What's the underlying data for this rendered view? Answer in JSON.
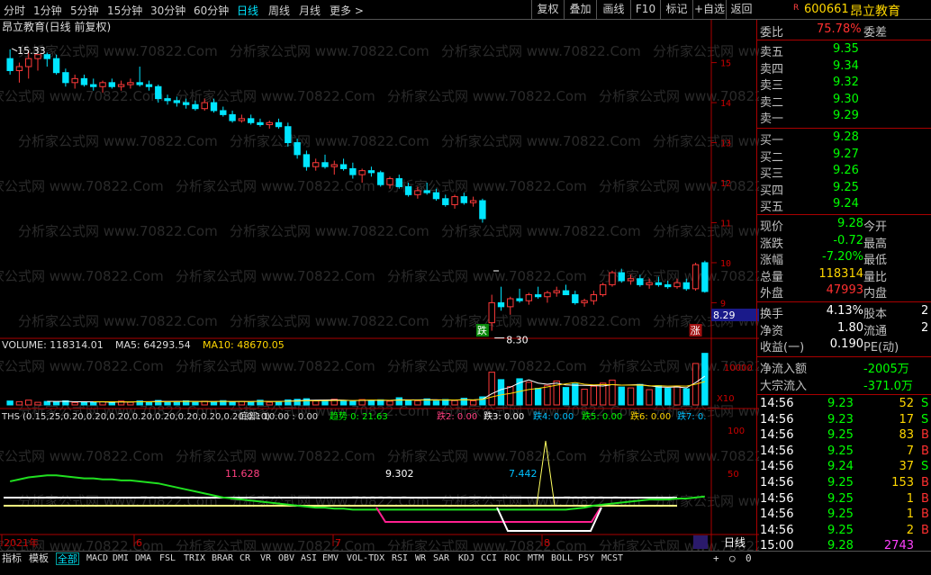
{
  "topbar": {
    "periods": [
      "分时",
      "1分钟",
      "5分钟",
      "15分钟",
      "30分钟",
      "60分钟",
      "日线",
      "周线",
      "月线",
      "更多 >"
    ],
    "active": "日线",
    "right": [
      "复权",
      "叠加",
      "画线",
      "F10",
      "标记",
      "+自选",
      "返回"
    ]
  },
  "stock": {
    "code": "600661",
    "name": "昂立教育",
    "mark": "R"
  },
  "chart_title": "昂立教育(日线 前复权)",
  "chart_data": [
    {
      "type": "candlestick",
      "ylim": [
        8.2,
        15.8
      ],
      "y_ticks": [
        9.0,
        10.0,
        11.0,
        12.0,
        13.0,
        14.0,
        15.0
      ],
      "high_label": "15.33",
      "low_label": "8.30",
      "current_price_label": "8.29",
      "markers": [
        "跌",
        "涨"
      ],
      "candles": [
        [
          15.1,
          15.33,
          14.7,
          14.8
        ],
        [
          14.8,
          15.0,
          14.5,
          14.9
        ],
        [
          14.9,
          15.3,
          14.6,
          15.1
        ],
        [
          15.1,
          15.2,
          14.8,
          15.2
        ],
        [
          15.2,
          15.25,
          14.9,
          15.1
        ],
        [
          15.1,
          15.2,
          14.7,
          14.75
        ],
        [
          14.75,
          14.85,
          14.4,
          14.5
        ],
        [
          14.5,
          14.7,
          14.35,
          14.6
        ],
        [
          14.6,
          14.7,
          14.4,
          14.45
        ],
        [
          14.45,
          14.6,
          14.3,
          14.4
        ],
        [
          14.4,
          14.55,
          14.25,
          14.5
        ],
        [
          14.5,
          14.6,
          14.35,
          14.4
        ],
        [
          14.4,
          14.55,
          14.3,
          14.45
        ],
        [
          14.45,
          14.6,
          14.35,
          14.5
        ],
        [
          14.5,
          14.9,
          14.4,
          14.45
        ],
        [
          14.45,
          14.55,
          14.3,
          14.4
        ],
        [
          14.4,
          14.45,
          14.0,
          14.1
        ],
        [
          14.1,
          14.2,
          13.95,
          14.05
        ],
        [
          14.05,
          14.15,
          13.9,
          14.0
        ],
        [
          14.0,
          14.1,
          13.85,
          13.95
        ],
        [
          13.95,
          14.05,
          13.8,
          13.85
        ],
        [
          13.85,
          14.1,
          13.8,
          14.0
        ],
        [
          14.0,
          14.1,
          13.75,
          13.8
        ],
        [
          13.8,
          13.9,
          13.65,
          13.7
        ],
        [
          13.7,
          13.8,
          13.5,
          13.55
        ],
        [
          13.55,
          13.7,
          13.5,
          13.6
        ],
        [
          13.6,
          13.7,
          13.45,
          13.5
        ],
        [
          13.5,
          13.6,
          13.4,
          13.45
        ],
        [
          13.45,
          13.55,
          13.35,
          13.5
        ],
        [
          13.5,
          13.6,
          13.35,
          13.4
        ],
        [
          13.4,
          13.5,
          12.9,
          13.0
        ],
        [
          13.0,
          13.1,
          12.6,
          12.7
        ],
        [
          12.7,
          12.8,
          12.3,
          12.4
        ],
        [
          12.4,
          12.6,
          12.3,
          12.5
        ],
        [
          12.5,
          12.7,
          12.35,
          12.4
        ],
        [
          12.4,
          12.55,
          12.2,
          12.45
        ],
        [
          12.45,
          12.6,
          12.3,
          12.35
        ],
        [
          12.35,
          12.5,
          12.1,
          12.2
        ],
        [
          12.2,
          12.35,
          12.0,
          12.3
        ],
        [
          12.3,
          12.4,
          12.15,
          12.25
        ],
        [
          12.25,
          12.3,
          11.9,
          11.95
        ],
        [
          11.95,
          12.15,
          11.85,
          12.1
        ],
        [
          12.1,
          12.2,
          11.85,
          11.9
        ],
        [
          11.9,
          12.0,
          11.65,
          11.7
        ],
        [
          11.7,
          11.9,
          11.6,
          11.8
        ],
        [
          11.8,
          12.0,
          11.7,
          11.75
        ],
        [
          11.75,
          11.85,
          11.55,
          11.6
        ],
        [
          11.6,
          11.7,
          11.4,
          11.45
        ],
        [
          11.45,
          11.7,
          11.35,
          11.65
        ],
        [
          11.65,
          11.75,
          11.45,
          11.5
        ],
        [
          11.5,
          11.65,
          11.4,
          11.55
        ],
        [
          11.55,
          11.6,
          11.0,
          11.1
        ],
        [
          8.5,
          9.2,
          8.3,
          9.0
        ],
        [
          9.0,
          9.4,
          8.8,
          8.9
        ],
        [
          8.9,
          9.15,
          8.7,
          9.1
        ],
        [
          9.1,
          9.35,
          9.0,
          9.05
        ],
        [
          9.05,
          9.25,
          8.95,
          9.2
        ],
        [
          9.2,
          9.4,
          9.1,
          9.15
        ],
        [
          9.15,
          9.3,
          9.0,
          9.25
        ],
        [
          9.25,
          9.4,
          9.15,
          9.3
        ],
        [
          9.3,
          9.45,
          9.2,
          9.2
        ],
        [
          9.2,
          9.3,
          8.95,
          9.0
        ],
        [
          9.0,
          9.1,
          8.9,
          9.05
        ],
        [
          9.05,
          9.3,
          8.95,
          9.2
        ],
        [
          9.2,
          9.5,
          9.15,
          9.45
        ],
        [
          9.45,
          9.8,
          9.4,
          9.75
        ],
        [
          9.75,
          9.85,
          9.5,
          9.55
        ],
        [
          9.55,
          9.7,
          9.45,
          9.6
        ],
        [
          9.6,
          9.7,
          9.4,
          9.45
        ],
        [
          9.45,
          9.6,
          9.35,
          9.5
        ],
        [
          9.5,
          9.65,
          9.4,
          9.45
        ],
        [
          9.45,
          9.55,
          9.35,
          9.4
        ],
        [
          9.4,
          9.6,
          9.35,
          9.5
        ],
        [
          9.5,
          9.6,
          9.3,
          9.35
        ],
        [
          9.35,
          10.0,
          9.3,
          9.95
        ],
        [
          10.0,
          10.05,
          9.25,
          9.28
        ]
      ]
    },
    {
      "type": "bar",
      "name": "VOLUME",
      "label": "VOLUME: 118314.01",
      "ma5_label": "MA5: 64293.54",
      "ma10_label": "MA10: 48670.05",
      "ylim": [
        0,
        13000
      ],
      "y_ticks": [
        10000
      ],
      "unit": "X10",
      "values": [
        9000,
        7500,
        11000,
        6000,
        8000,
        7000,
        9500,
        5500,
        6500,
        5800,
        7200,
        6000,
        8800,
        6200,
        9100,
        7300,
        10200,
        6800,
        7700,
        9400,
        6100,
        8500,
        7000,
        9800,
        6600,
        8200,
        7400,
        10800,
        6300,
        7900,
        11500,
        12800,
        14200,
        9200,
        8600,
        13000,
        9900,
        8100,
        12200,
        10500,
        11800,
        8700,
        16500,
        10900,
        9500,
        13800,
        8900,
        12400,
        10100,
        15200,
        9600,
        18500,
        75000,
        58000,
        42000,
        60000,
        52000,
        38000,
        45000,
        55000,
        40000,
        48000,
        36000,
        43000,
        50000,
        57000,
        41000,
        39000,
        47000,
        35000,
        44000,
        38000,
        42000,
        37000,
        95000,
        118314
      ]
    },
    {
      "type": "line",
      "name": "THS",
      "label": "THS (0.15,25,0.20,0.20,0.20,0.20,0.20,0.20,0.20,0.20,0.10)",
      "ylim": [
        0,
        100
      ],
      "y_ticks": [
        100.0,
        50.0
      ],
      "items": [
        {
          "label": "底部: 10.00 : 0.00"
        },
        {
          "label": "趋势 0: 21.63"
        },
        {
          "label": "跌2: 0.00"
        },
        {
          "label": "跌3: 0.00"
        },
        {
          "label": "跌4: 0.00"
        },
        {
          "label": "跌5: 0.00"
        },
        {
          "label": "跌6: 0.00"
        },
        {
          "label": "跌7: 0."
        }
      ],
      "annotations": [
        "11.628",
        "9.302",
        "7.442"
      ],
      "trend": [
        42,
        44,
        46,
        47,
        48,
        48,
        47,
        46,
        45,
        45,
        44,
        44,
        43,
        43,
        42,
        41,
        40,
        38,
        36,
        34,
        32,
        30,
        28,
        26,
        25,
        24,
        23,
        22,
        21,
        20,
        19,
        18,
        17,
        16,
        16,
        15,
        15,
        14,
        14,
        14,
        14,
        14,
        14,
        14,
        14,
        14,
        14,
        14,
        14,
        14,
        14,
        14,
        14,
        14,
        14,
        14,
        14,
        14,
        14,
        14,
        14,
        15,
        16,
        18,
        19,
        20,
        21,
        22,
        23,
        24,
        24,
        24,
        25,
        25,
        26,
        27
      ]
    }
  ],
  "x_labels": [
    "2021年",
    "6",
    "7",
    "8"
  ],
  "period_label": "日线",
  "right": {
    "wei_bi": {
      "label": "委比",
      "value": "75.78%",
      "label2": "委差"
    },
    "sells": [
      [
        "卖五",
        "9.35"
      ],
      [
        "卖四",
        "9.34"
      ],
      [
        "卖三",
        "9.32"
      ],
      [
        "卖二",
        "9.30"
      ],
      [
        "卖一",
        "9.29"
      ]
    ],
    "buys": [
      [
        "买一",
        "9.28"
      ],
      [
        "买二",
        "9.27"
      ],
      [
        "买三",
        "9.26"
      ],
      [
        "买四",
        "9.25"
      ],
      [
        "买五",
        "9.24"
      ]
    ],
    "quote": [
      [
        "现价",
        "9.28",
        "今开"
      ],
      [
        "涨跌",
        "-0.72",
        "最高"
      ],
      [
        "涨幅",
        "-7.20%",
        "最低"
      ],
      [
        "总量",
        "118314",
        "量比"
      ],
      [
        "外盘",
        "47993",
        "内盘"
      ]
    ],
    "quote2": [
      [
        "换手",
        "4.13%",
        "股本",
        "2"
      ],
      [
        "净资",
        "1.80",
        "流通",
        "2"
      ],
      [
        "收益(一)",
        "0.190",
        "PE(动)",
        ""
      ]
    ],
    "flow": [
      [
        "净流入额",
        "-2005万"
      ],
      [
        "大宗流入",
        "-371.0万"
      ]
    ],
    "ticks": [
      [
        "14:56",
        "9.23",
        "52",
        "S"
      ],
      [
        "14:56",
        "9.23",
        "17",
        "S"
      ],
      [
        "14:56",
        "9.25",
        "83",
        "B"
      ],
      [
        "14:56",
        "9.25",
        "7",
        "B"
      ],
      [
        "14:56",
        "9.24",
        "37",
        "S"
      ],
      [
        "14:56",
        "9.25",
        "153",
        "B"
      ],
      [
        "14:56",
        "9.25",
        "1",
        "B"
      ],
      [
        "14:56",
        "9.25",
        "1",
        "B"
      ],
      [
        "14:56",
        "9.25",
        "2",
        "B"
      ],
      [
        "15:00",
        "9.28",
        "2743",
        ""
      ]
    ]
  },
  "bottom": {
    "tabs": [
      "指标",
      "模板",
      "全部"
    ],
    "indicators": [
      "MACD",
      "DMI",
      "DMA",
      "FSL",
      "TRIX",
      "BRAR",
      "CR",
      "VR",
      "OBV",
      "ASI",
      "EMV",
      "VOL-TDX",
      "RSI",
      "WR",
      "SAR",
      "KDJ",
      "CCI",
      "ROC",
      "MTM",
      "BOLL",
      "PSY",
      "MCST"
    ],
    "controls": [
      "+",
      "○",
      "0"
    ]
  },
  "watermark": "分析家公式网 www.70822.Com"
}
